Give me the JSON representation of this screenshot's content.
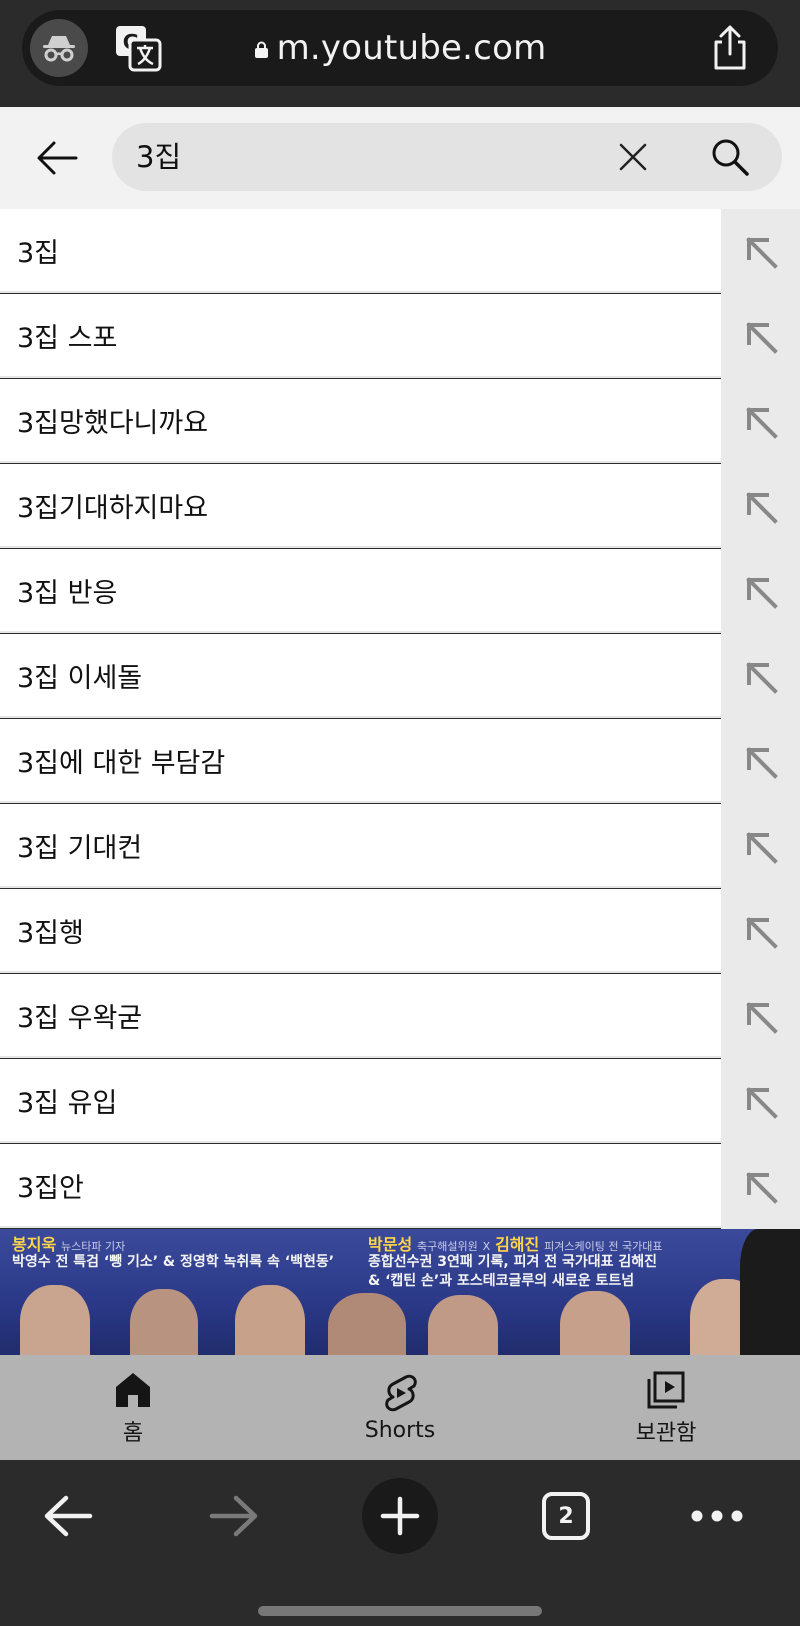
{
  "browser": {
    "url": "m.youtube.com",
    "tabs_count": "2"
  },
  "search": {
    "query": "3집"
  },
  "suggestions": [
    "3집",
    "3집 스포",
    "3집망했다니까요",
    "3집기대하지마요",
    "3집 반응",
    "3집 이세돌",
    "3집에 대한 부담감",
    "3집 기대컨",
    "3집행",
    "3집 우왁굳",
    "3집 유입",
    "3집안"
  ],
  "thumbnail": {
    "left_name": "봉지욱",
    "left_role": "뉴스타파 기자",
    "left_headline": "박영수 전 특검 ‘뺑 기소’ & 정영학 녹취록 속 ‘백현동’",
    "right_name_1": "박문성",
    "right_role_1": "축구해설위원",
    "right_x": "X",
    "right_name_2": "김해진",
    "right_role_2": "피겨스케이팅 전 국가대표",
    "right_line_1": "종합선수권 3연패 기록, 피겨 전 국가대표 김해진",
    "right_line_2": "& ‘캡틴 손’과 포스테코글루의 새로운 토트넘"
  },
  "yt_nav": {
    "home": "홈",
    "shorts": "Shorts",
    "library": "보관함"
  },
  "colors": {
    "header_bg": "#f2f2f2",
    "search_box": "#e3e3e3",
    "browser_chrome": "#2b2b2b",
    "nav_bg": "#b3b3b3"
  }
}
